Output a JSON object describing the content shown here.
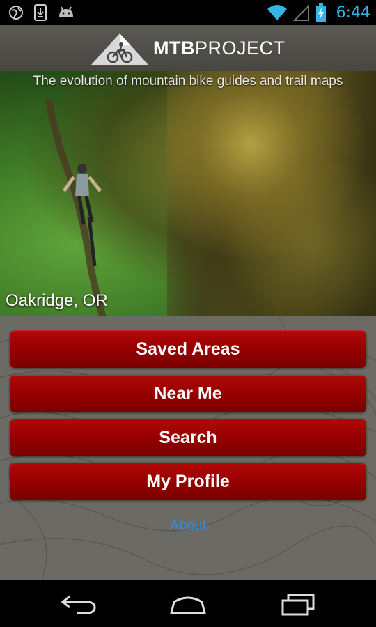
{
  "status_bar": {
    "time": "6:44",
    "icons": [
      "globe-notification-icon",
      "download-notification-icon",
      "android-notification-icon",
      "wifi-icon",
      "signal-icon",
      "battery-charging-icon"
    ]
  },
  "header": {
    "logo_bold": "MTB",
    "logo_light": "PROJECT"
  },
  "hero": {
    "tagline": "The evolution of mountain bike guides and trail maps",
    "location": "Oakridge, OR"
  },
  "menu": {
    "saved_areas": "Saved Areas",
    "near_me": "Near Me",
    "search": "Search",
    "my_profile": "My Profile",
    "about": "About"
  },
  "colors": {
    "button_red": "#990000",
    "link_blue": "#2f8fe0",
    "status_blue": "#33b5e5"
  },
  "nav_bar": {
    "icons": [
      "back-icon",
      "home-icon",
      "recent-apps-icon"
    ]
  }
}
